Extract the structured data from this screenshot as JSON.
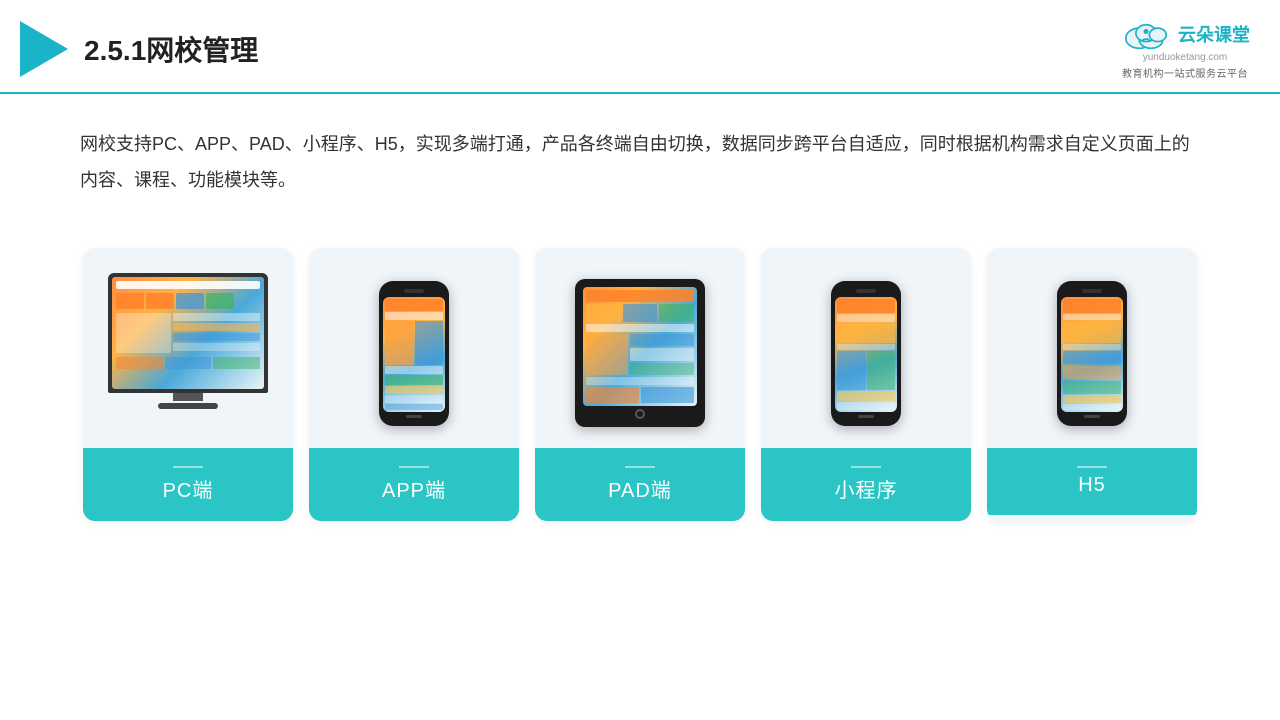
{
  "header": {
    "section_number": "2.5.1",
    "title": "网校管理",
    "logo_name": "云朵课堂",
    "logo_url": "yunduoketang.com",
    "logo_tagline": "教育机构一站\n式服务云平台"
  },
  "description": {
    "text": "网校支持PC、APP、PAD、小程序、H5，实现多端打通，产品各终端自由切换，数据同步跨平台自适应，同时根据机构需求自定义页面上的内容、课程、功能模块等。"
  },
  "cards": [
    {
      "id": "pc",
      "label": "PC端"
    },
    {
      "id": "app",
      "label": "APP端"
    },
    {
      "id": "pad",
      "label": "PAD端"
    },
    {
      "id": "miniprogram",
      "label": "小程序"
    },
    {
      "id": "h5",
      "label": "H5"
    }
  ],
  "colors": {
    "accent": "#2cc5c5",
    "header_border": "#1ab3c8",
    "card_bg": "#f0f5fa",
    "card_label_bg": "#2cc5c5",
    "title_color": "#222"
  }
}
